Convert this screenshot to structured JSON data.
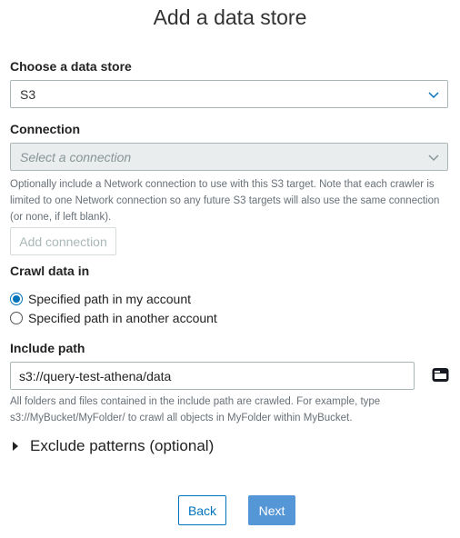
{
  "title": "Add a data store",
  "choose_store": {
    "label": "Choose a data store",
    "value": "S3"
  },
  "connection": {
    "label": "Connection",
    "placeholder": "Select a connection",
    "help": "Optionally include a Network connection to use with this S3 target. Note that each crawler is limited to one Network connection so any future S3 targets will also use the same connection (or none, if left blank).",
    "add_button": "Add connection"
  },
  "crawl": {
    "label": "Crawl data in",
    "options": [
      {
        "label": "Specified path in my account",
        "checked": true
      },
      {
        "label": "Specified path in another account",
        "checked": false
      }
    ]
  },
  "include_path": {
    "label": "Include path",
    "value": "s3://query-test-athena/data",
    "help": "All folders and files contained in the include path are crawled. For example, type s3://MyBucket/MyFolder/ to crawl all objects in MyFolder within MyBucket.",
    "browse_icon": "folder-icon"
  },
  "exclude": {
    "label": "Exclude patterns (optional)"
  },
  "footer": {
    "back_label": "Back",
    "next_label": "Next"
  },
  "colors": {
    "accent": "#0073bb",
    "primary_button": "#5596d6",
    "disabled_bg": "#eaeded",
    "help_text": "#687078"
  }
}
